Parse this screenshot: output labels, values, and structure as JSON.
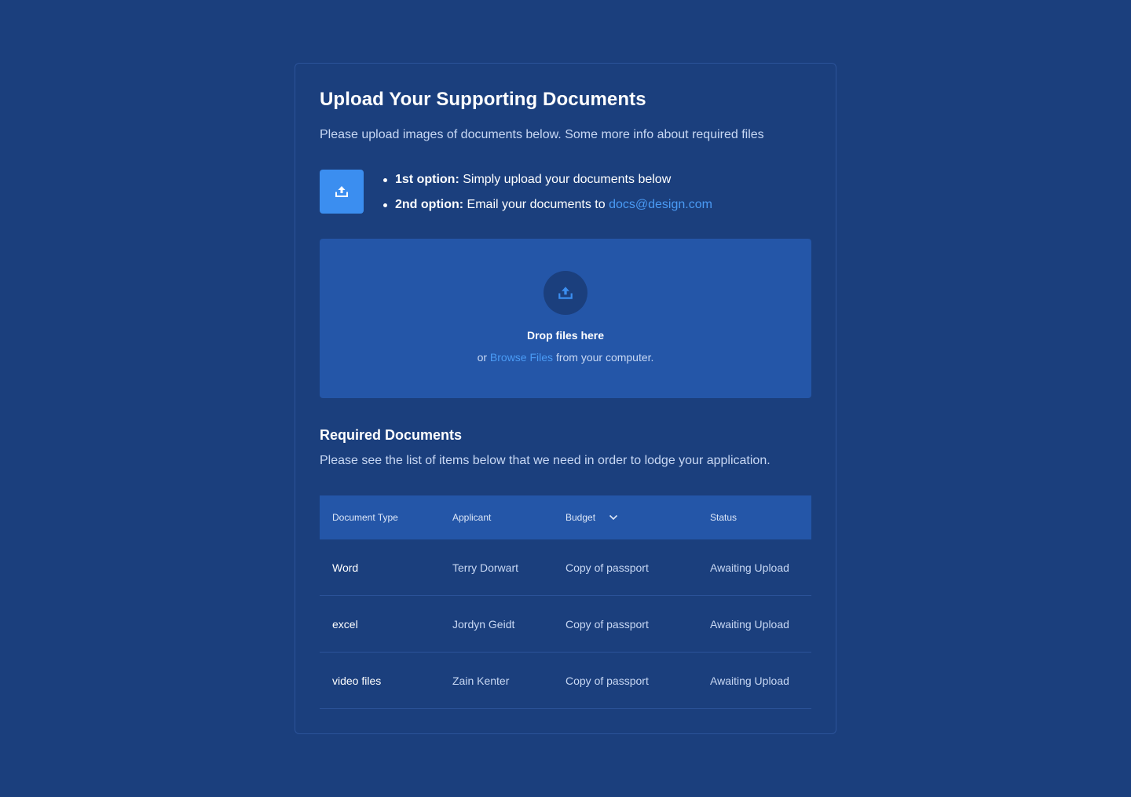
{
  "page": {
    "title": "Upload Your Supporting Documents",
    "subtitle": "Please upload images of documents below. Some more info about required files"
  },
  "options": {
    "first_label": "1st option:",
    "first_text": "Simply upload your documents below",
    "second_label": "2nd option:",
    "second_text": "Email your documents to",
    "email": "docs@design.com"
  },
  "dropzone": {
    "title": "Drop files here",
    "prefix": "or",
    "browse_label": "Browse Files",
    "suffix": "from your computer."
  },
  "required": {
    "title": "Required Documents",
    "subtitle": "Please see the list of items below that we need in order to lodge your application."
  },
  "table": {
    "headers": {
      "document_type": "Document Type",
      "applicant": "Applicant",
      "budget": "Budget",
      "status": "Status"
    },
    "rows": [
      {
        "document_type": "Word",
        "applicant": "Terry Dorwart",
        "budget": "Copy of passport",
        "status": "Awaiting Upload"
      },
      {
        "document_type": "excel",
        "applicant": "Jordyn Geidt",
        "budget": "Copy of passport",
        "status": "Awaiting Upload"
      },
      {
        "document_type": "video files",
        "applicant": "Zain Kenter",
        "budget": "Copy of passport",
        "status": "Awaiting Upload"
      }
    ]
  },
  "icons": {
    "upload": "upload-icon",
    "sort": "chevron-down-icon"
  },
  "colors": {
    "background": "#1b3f7d",
    "panel": "#2456a8",
    "accent": "#3b8ef0",
    "link": "#4a9bf5"
  }
}
